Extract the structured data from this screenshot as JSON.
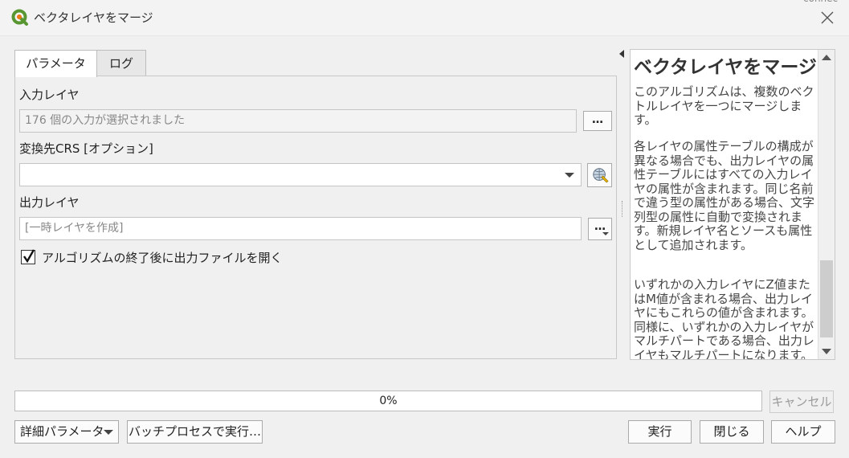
{
  "window": {
    "title": "ベクタレイヤをマージ",
    "corner_text": "connec"
  },
  "tabs": [
    {
      "label": "パラメータ",
      "active": true
    },
    {
      "label": "ログ",
      "active": false
    }
  ],
  "parameters": {
    "input_layers": {
      "label": "入力レイヤ",
      "value": "176 個の入力が選択されました",
      "button_label": "…"
    },
    "target_crs": {
      "label": "変換先CRS [オプション]",
      "value": ""
    },
    "output_layer": {
      "label": "出力レイヤ",
      "value": "[一時レイヤを作成]",
      "button_label": "…"
    },
    "open_output": {
      "label": "アルゴリズムの終了後に出力ファイルを開く",
      "checked": true
    }
  },
  "help": {
    "title": "ベクタレイヤをマージ",
    "paragraphs": [
      "このアルゴリズムは、複数のベクトルレイヤを一つにマージします。",
      "各レイヤの属性テーブルの構成が異なる場合でも、出力レイヤの属性テーブルにはすべての入力レイヤの属性が含まれます。同じ名前で違う型の属性がある場合、文字列型の属性に自動で変換されます。新規レイヤ名とソースも属性として追加されます。",
      "いずれかの入力レイヤにZ値またはM値が含まれる場合、出力レイヤにもこれらの値が含まれます。同様に、いずれかの入力レイヤがマルチパートである場合、出力レイヤもマルチパートになります。"
    ]
  },
  "progress": {
    "value": 0,
    "label": "0%"
  },
  "buttons": {
    "cancel": "キャンセル",
    "advanced": "詳細パラメータ",
    "batch": "バッチプロセスで実行…",
    "run": "実行",
    "close": "閉じる",
    "help": "ヘルプ"
  },
  "colors": {
    "app_icon_green": "#589632",
    "app_icon_yellow": "#ee7913"
  }
}
